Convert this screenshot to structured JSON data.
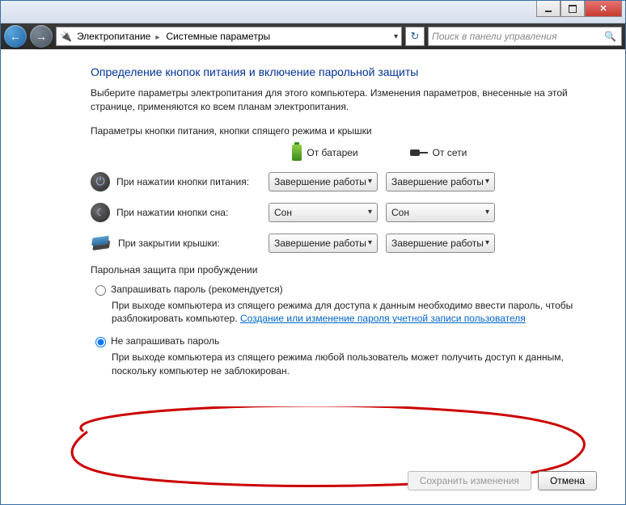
{
  "breadcrumb": {
    "seg1": "Электропитание",
    "seg2": "Системные параметры"
  },
  "search_placeholder": "Поиск в панели управления",
  "title": "Определение кнопок питания и включение парольной защиты",
  "description": "Выберите параметры электропитания для этого компьютера. Изменения параметров, внесенные на этой странице, применяются ко всем планам электропитания.",
  "section1_header": "Параметры кнопки питания, кнопки спящего режима и крышки",
  "col_battery": "От батареи",
  "col_ac": "От сети",
  "rows": {
    "power": {
      "label": "При нажатии кнопки питания:",
      "bat": "Завершение работы",
      "ac": "Завершение работы"
    },
    "sleep": {
      "label": "При нажатии кнопки сна:",
      "bat": "Сон",
      "ac": "Сон"
    },
    "lid": {
      "label": "При закрытии крышки:",
      "bat": "Завершение работы",
      "ac": "Завершение работы"
    }
  },
  "section2_header": "Парольная защита при пробуждении",
  "radio1": {
    "label": "Запрашивать пароль (рекомендуется)",
    "desc_before": "При выходе компьютера из спящего режима для доступа к данным необходимо ввести пароль, чтобы разблокировать компьютер. ",
    "link": "Создание или изменение пароля учетной записи пользователя"
  },
  "radio2": {
    "label": "Не запрашивать пароль",
    "desc": "При выходе компьютера из спящего режима любой пользователь может получить доступ к данным, поскольку компьютер не заблокирован."
  },
  "buttons": {
    "save": "Сохранить изменения",
    "cancel": "Отмена"
  }
}
